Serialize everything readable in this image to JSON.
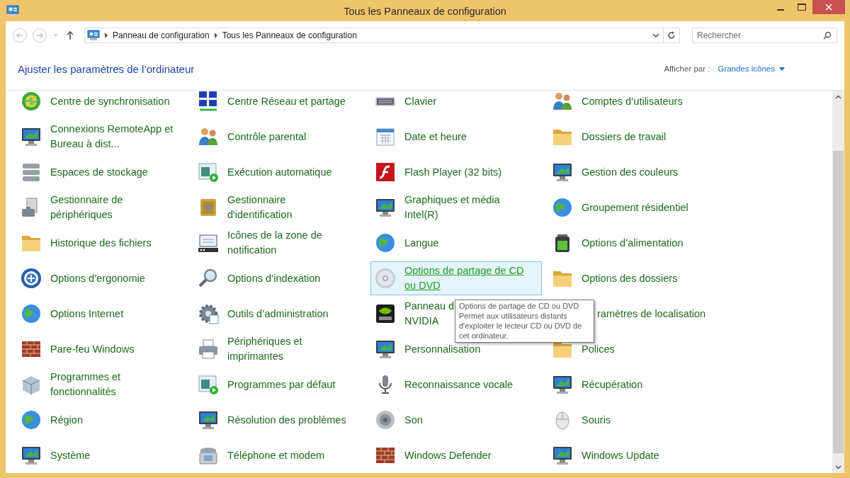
{
  "window": {
    "title": "Tous les Panneaux de configuration"
  },
  "address_bar": {
    "breadcrumbs": [
      "Panneau de configuration",
      "Tous les Panneaux de configuration"
    ]
  },
  "search": {
    "placeholder": "Rechercher"
  },
  "heading": "Ajuster les paramètres de l’ordinateur",
  "view": {
    "label": "Afficher par :",
    "value": "Grandes icônes"
  },
  "items": [
    {
      "lines": [
        "Centre de synchronisation"
      ],
      "hovered": false
    },
    {
      "lines": [
        "Centre Réseau et partage"
      ],
      "hovered": false
    },
    {
      "lines": [
        "Clavier"
      ],
      "hovered": false
    },
    {
      "lines": [
        "Comptes d’utilisateurs"
      ],
      "hovered": false
    },
    {
      "lines": [
        "Connexions RemoteApp et",
        "Bureau à dist..."
      ],
      "hovered": false
    },
    {
      "lines": [
        "Contrôle parental"
      ],
      "hovered": false
    },
    {
      "lines": [
        "Date et heure"
      ],
      "hovered": false
    },
    {
      "lines": [
        "Dossiers de travail"
      ],
      "hovered": false
    },
    {
      "lines": [
        "Espaces de stockage"
      ],
      "hovered": false
    },
    {
      "lines": [
        "Exécution automatique"
      ],
      "hovered": false
    },
    {
      "lines": [
        "Flash Player (32 bits)"
      ],
      "hovered": false
    },
    {
      "lines": [
        "Gestion des couleurs"
      ],
      "hovered": false
    },
    {
      "lines": [
        "Gestionnaire de",
        "périphériques"
      ],
      "hovered": false
    },
    {
      "lines": [
        "Gestionnaire",
        "d'identification"
      ],
      "hovered": false
    },
    {
      "lines": [
        "Graphiques et média",
        "Intel(R)"
      ],
      "hovered": false
    },
    {
      "lines": [
        "Groupement résidentiel"
      ],
      "hovered": false
    },
    {
      "lines": [
        "Historique des fichiers"
      ],
      "hovered": false
    },
    {
      "lines": [
        "Icônes de la zone de",
        "notification"
      ],
      "hovered": false
    },
    {
      "lines": [
        "Langue"
      ],
      "hovered": false
    },
    {
      "lines": [
        "Options d’alimentation"
      ],
      "hovered": false
    },
    {
      "lines": [
        "Options d’ergonomie"
      ],
      "hovered": false
    },
    {
      "lines": [
        "Options d’indexation"
      ],
      "hovered": false
    },
    {
      "lines": [
        "Options de partage de CD",
        "ou DVD"
      ],
      "hovered": true
    },
    {
      "lines": [
        "Options des dossiers"
      ],
      "hovered": false
    },
    {
      "lines": [
        "Options Internet"
      ],
      "hovered": false
    },
    {
      "lines": [
        "Outils d’administration"
      ],
      "hovered": false
    },
    {
      "lines": [
        "Panneau d",
        "NVIDIA"
      ],
      "hovered": false
    },
    {
      "lines": [
        "ramètres de localisation"
      ],
      "hovered": false,
      "kind": "cut"
    },
    {
      "lines": [
        "Pare-feu Windows"
      ],
      "hovered": false
    },
    {
      "lines": [
        "Périphériques et",
        "imprimantes"
      ],
      "hovered": false
    },
    {
      "lines": [
        "Personnalisation"
      ],
      "hovered": false
    },
    {
      "lines": [
        "Polices"
      ],
      "hovered": false
    },
    {
      "lines": [
        "Programmes et",
        "fonctionnalités"
      ],
      "hovered": false
    },
    {
      "lines": [
        "Programmes par défaut"
      ],
      "hovered": false
    },
    {
      "lines": [
        "Reconnaissance vocale"
      ],
      "hovered": false
    },
    {
      "lines": [
        "Récupération"
      ],
      "hovered": false
    },
    {
      "lines": [
        "Région"
      ],
      "hovered": false
    },
    {
      "lines": [
        "Résolution des problèmes"
      ],
      "hovered": false
    },
    {
      "lines": [
        "Son"
      ],
      "hovered": false
    },
    {
      "lines": [
        "Souris"
      ],
      "hovered": false
    },
    {
      "lines": [
        "Système"
      ],
      "hovered": false
    },
    {
      "lines": [
        "Téléphone et modem"
      ],
      "hovered": false
    },
    {
      "lines": [
        "Windows Defender"
      ],
      "hovered": false
    },
    {
      "lines": [
        "Windows Update"
      ],
      "hovered": false
    }
  ],
  "tooltip": {
    "title": "Options de partage de CD ou DVD",
    "description": "Permet aux utilisateurs distants d'exploiter le lecteur CD ou DVD de cet ordinateur."
  }
}
